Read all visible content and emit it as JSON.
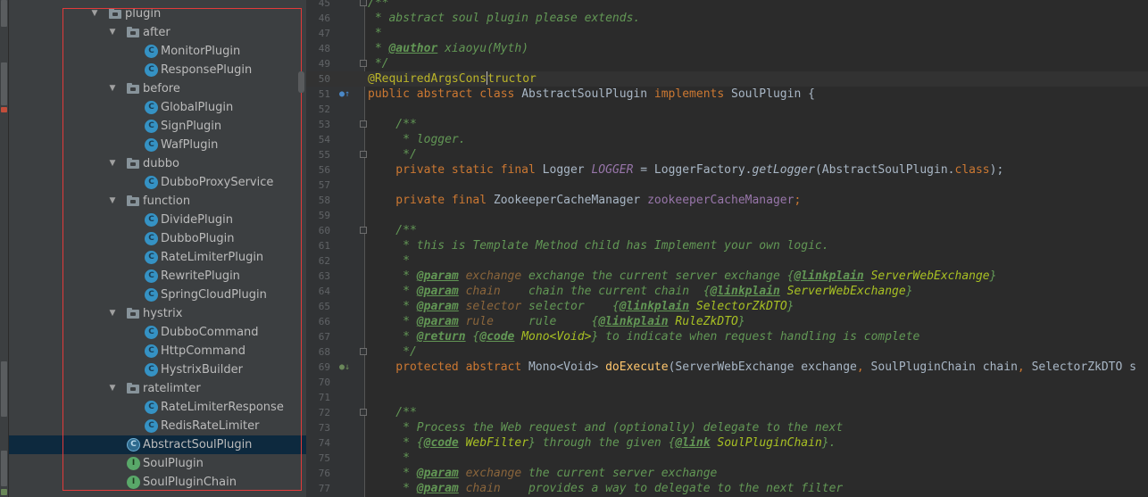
{
  "project_tree": {
    "items": [
      {
        "label": "plugin",
        "kind": "folder",
        "expanded": true,
        "depth": 0
      },
      {
        "label": "after",
        "kind": "folder",
        "expanded": true,
        "depth": 1
      },
      {
        "label": "MonitorPlugin",
        "kind": "class",
        "depth": 2
      },
      {
        "label": "ResponsePlugin",
        "kind": "class",
        "depth": 2
      },
      {
        "label": "before",
        "kind": "folder",
        "expanded": true,
        "depth": 1
      },
      {
        "label": "GlobalPlugin",
        "kind": "class",
        "depth": 2
      },
      {
        "label": "SignPlugin",
        "kind": "class",
        "depth": 2
      },
      {
        "label": "WafPlugin",
        "kind": "class",
        "depth": 2
      },
      {
        "label": "dubbo",
        "kind": "folder",
        "expanded": true,
        "depth": 1
      },
      {
        "label": "DubboProxyService",
        "kind": "class",
        "depth": 2
      },
      {
        "label": "function",
        "kind": "folder",
        "expanded": true,
        "depth": 1
      },
      {
        "label": "DividePlugin",
        "kind": "class",
        "depth": 2
      },
      {
        "label": "DubboPlugin",
        "kind": "class",
        "depth": 2
      },
      {
        "label": "RateLimiterPlugin",
        "kind": "class",
        "depth": 2
      },
      {
        "label": "RewritePlugin",
        "kind": "class",
        "depth": 2
      },
      {
        "label": "SpringCloudPlugin",
        "kind": "class",
        "depth": 2
      },
      {
        "label": "hystrix",
        "kind": "folder",
        "expanded": true,
        "depth": 1
      },
      {
        "label": "DubboCommand",
        "kind": "class",
        "depth": 2
      },
      {
        "label": "HttpCommand",
        "kind": "class",
        "depth": 2
      },
      {
        "label": "HystrixBuilder",
        "kind": "class",
        "depth": 2
      },
      {
        "label": "ratelimter",
        "kind": "folder",
        "expanded": true,
        "depth": 1
      },
      {
        "label": "RateLimiterResponse",
        "kind": "class",
        "depth": 2
      },
      {
        "label": "RedisRateLimiter",
        "kind": "class",
        "depth": 2
      },
      {
        "label": "AbstractSoulPlugin",
        "kind": "abstract",
        "depth": 1,
        "selected": true
      },
      {
        "label": "SoulPlugin",
        "kind": "interface",
        "depth": 1
      },
      {
        "label": "SoulPluginChain",
        "kind": "interface",
        "depth": 1
      }
    ],
    "icon_letters": {
      "class": "C",
      "abstract": "C",
      "interface": "I"
    }
  },
  "editor": {
    "lines": [
      {
        "no": "45",
        "fold": true,
        "segs": [
          {
            "t": "/**",
            "c": "comment"
          }
        ]
      },
      {
        "no": "46",
        "segs": [
          {
            "t": " * abstract soul plugin please extends.",
            "c": "comment"
          }
        ]
      },
      {
        "no": "47",
        "segs": [
          {
            "t": " *",
            "c": "comment"
          }
        ]
      },
      {
        "no": "48",
        "segs": [
          {
            "t": " * ",
            "c": "comment"
          },
          {
            "t": "@author",
            "c": "tag"
          },
          {
            "t": " xiaoyu(Myth)",
            "c": "comment"
          }
        ]
      },
      {
        "no": "49",
        "fold": true,
        "segs": [
          {
            "t": " */",
            "c": "comment"
          }
        ]
      },
      {
        "no": "50",
        "caret": true,
        "segs": [
          {
            "t": "@RequiredArgsCons",
            "c": "anno"
          },
          {
            "t": "",
            "c": "caret"
          },
          {
            "t": "tructor",
            "c": "anno"
          }
        ]
      },
      {
        "no": "51",
        "mark": "override",
        "segs": [
          {
            "t": "public abstract class ",
            "c": "kw"
          },
          {
            "t": "AbstractSoulPlugin ",
            "c": "plain"
          },
          {
            "t": "implements ",
            "c": "kw"
          },
          {
            "t": "SoulPlugin {",
            "c": "plain"
          }
        ]
      },
      {
        "no": "52",
        "segs": []
      },
      {
        "no": "53",
        "fold": true,
        "segs": [
          {
            "t": "    /**",
            "c": "comment"
          }
        ]
      },
      {
        "no": "54",
        "segs": [
          {
            "t": "     * logger.",
            "c": "comment"
          }
        ]
      },
      {
        "no": "55",
        "fold": true,
        "segs": [
          {
            "t": "     */",
            "c": "comment"
          }
        ]
      },
      {
        "no": "56",
        "segs": [
          {
            "t": "    private static final ",
            "c": "kw"
          },
          {
            "t": "Logger ",
            "c": "plain"
          },
          {
            "t": "LOGGER",
            "c": "field-static"
          },
          {
            "t": " = LoggerFactory.",
            "c": "plain"
          },
          {
            "t": "getLogger",
            "c": "static-call"
          },
          {
            "t": "(AbstractSoulPlugin.",
            "c": "plain"
          },
          {
            "t": "class",
            "c": "kw"
          },
          {
            "t": ");",
            "c": "plain"
          }
        ]
      },
      {
        "no": "57",
        "segs": []
      },
      {
        "no": "58",
        "segs": [
          {
            "t": "    private final ",
            "c": "kw"
          },
          {
            "t": "ZookeeperCacheManager ",
            "c": "plain"
          },
          {
            "t": "zookeeperCacheManager",
            "c": "field"
          },
          {
            "t": ";",
            "c": "kw"
          }
        ]
      },
      {
        "no": "59",
        "segs": []
      },
      {
        "no": "60",
        "fold": true,
        "segs": [
          {
            "t": "    /**",
            "c": "comment"
          }
        ]
      },
      {
        "no": "61",
        "segs": [
          {
            "t": "     * this is Template Method child has Implement your own logic.",
            "c": "comment"
          }
        ]
      },
      {
        "no": "62",
        "segs": [
          {
            "t": "     *",
            "c": "comment"
          }
        ]
      },
      {
        "no": "63",
        "segs": [
          {
            "t": "     * ",
            "c": "comment"
          },
          {
            "t": "@param",
            "c": "tag"
          },
          {
            "t": " ",
            "c": "comment"
          },
          {
            "t": "exchange",
            "c": "param"
          },
          {
            "t": " exchange the current server exchange {",
            "c": "comment"
          },
          {
            "t": "@linkplain",
            "c": "tag"
          },
          {
            "t": " ",
            "c": "comment"
          },
          {
            "t": "ServerWebExchange",
            "c": "ref"
          },
          {
            "t": "}",
            "c": "comment"
          }
        ]
      },
      {
        "no": "64",
        "segs": [
          {
            "t": "     * ",
            "c": "comment"
          },
          {
            "t": "@param",
            "c": "tag"
          },
          {
            "t": " ",
            "c": "comment"
          },
          {
            "t": "chain",
            "c": "param"
          },
          {
            "t": "    chain the current chain  {",
            "c": "comment"
          },
          {
            "t": "@linkplain",
            "c": "tag"
          },
          {
            "t": " ",
            "c": "comment"
          },
          {
            "t": "ServerWebExchange",
            "c": "ref"
          },
          {
            "t": "}",
            "c": "comment"
          }
        ]
      },
      {
        "no": "65",
        "segs": [
          {
            "t": "     * ",
            "c": "comment"
          },
          {
            "t": "@param",
            "c": "tag"
          },
          {
            "t": " ",
            "c": "comment"
          },
          {
            "t": "selector",
            "c": "param"
          },
          {
            "t": " selector    {",
            "c": "comment"
          },
          {
            "t": "@linkplain",
            "c": "tag"
          },
          {
            "t": " ",
            "c": "comment"
          },
          {
            "t": "SelectorZkDTO",
            "c": "ref"
          },
          {
            "t": "}",
            "c": "comment"
          }
        ]
      },
      {
        "no": "66",
        "segs": [
          {
            "t": "     * ",
            "c": "comment"
          },
          {
            "t": "@param",
            "c": "tag"
          },
          {
            "t": " ",
            "c": "comment"
          },
          {
            "t": "rule",
            "c": "param"
          },
          {
            "t": "     rule     {",
            "c": "comment"
          },
          {
            "t": "@linkplain",
            "c": "tag"
          },
          {
            "t": " ",
            "c": "comment"
          },
          {
            "t": "RuleZkDTO",
            "c": "ref"
          },
          {
            "t": "}",
            "c": "comment"
          }
        ]
      },
      {
        "no": "67",
        "segs": [
          {
            "t": "     * ",
            "c": "comment"
          },
          {
            "t": "@return",
            "c": "tag"
          },
          {
            "t": " {",
            "c": "comment"
          },
          {
            "t": "@code",
            "c": "tag"
          },
          {
            "t": " ",
            "c": "comment"
          },
          {
            "t": "Mono<Void>",
            "c": "ref"
          },
          {
            "t": "} to indicate when request handling is complete",
            "c": "comment"
          }
        ]
      },
      {
        "no": "68",
        "fold": true,
        "segs": [
          {
            "t": "     */",
            "c": "comment"
          }
        ]
      },
      {
        "no": "69",
        "mark": "impl",
        "segs": [
          {
            "t": "    protected abstract ",
            "c": "kw"
          },
          {
            "t": "Mono<Void> ",
            "c": "plain"
          },
          {
            "t": "doExecute",
            "c": "method"
          },
          {
            "t": "(ServerWebExchange exchange",
            "c": "plain"
          },
          {
            "t": ", ",
            "c": "kw"
          },
          {
            "t": "SoulPluginChain chain",
            "c": "plain"
          },
          {
            "t": ", ",
            "c": "kw"
          },
          {
            "t": "SelectorZkDTO s",
            "c": "plain"
          }
        ]
      },
      {
        "no": "70",
        "segs": []
      },
      {
        "no": "71",
        "segs": []
      },
      {
        "no": "72",
        "fold": true,
        "segs": [
          {
            "t": "    /**",
            "c": "comment"
          }
        ]
      },
      {
        "no": "73",
        "segs": [
          {
            "t": "     * Process the Web request and (optionally) delegate to the next",
            "c": "comment"
          }
        ]
      },
      {
        "no": "74",
        "segs": [
          {
            "t": "     * {",
            "c": "comment"
          },
          {
            "t": "@code",
            "c": "tag"
          },
          {
            "t": " ",
            "c": "comment"
          },
          {
            "t": "WebFilter",
            "c": "ref"
          },
          {
            "t": "} through the given {",
            "c": "comment"
          },
          {
            "t": "@link",
            "c": "tag"
          },
          {
            "t": " ",
            "c": "comment"
          },
          {
            "t": "SoulPluginChain",
            "c": "ref"
          },
          {
            "t": "}.",
            "c": "comment"
          }
        ]
      },
      {
        "no": "75",
        "segs": [
          {
            "t": "     *",
            "c": "comment"
          }
        ]
      },
      {
        "no": "76",
        "segs": [
          {
            "t": "     * ",
            "c": "comment"
          },
          {
            "t": "@param",
            "c": "tag"
          },
          {
            "t": " ",
            "c": "comment"
          },
          {
            "t": "exchange",
            "c": "param"
          },
          {
            "t": " the current server exchange",
            "c": "comment"
          }
        ]
      },
      {
        "no": "77",
        "segs": [
          {
            "t": "     * ",
            "c": "comment"
          },
          {
            "t": "@param",
            "c": "tag"
          },
          {
            "t": " ",
            "c": "comment"
          },
          {
            "t": "chain",
            "c": "param"
          },
          {
            "t": "    provides a way to delegate to the next filter",
            "c": "comment"
          }
        ]
      }
    ]
  },
  "colors": {
    "editor_bg": "#2b2b2b",
    "tree_bg": "#3c3f41",
    "selection": "#0d293e",
    "highlight_box": "#e23a3a",
    "keyword": "#cc7832",
    "comment": "#629755",
    "annotation": "#bbb529",
    "method": "#ffc66d"
  }
}
